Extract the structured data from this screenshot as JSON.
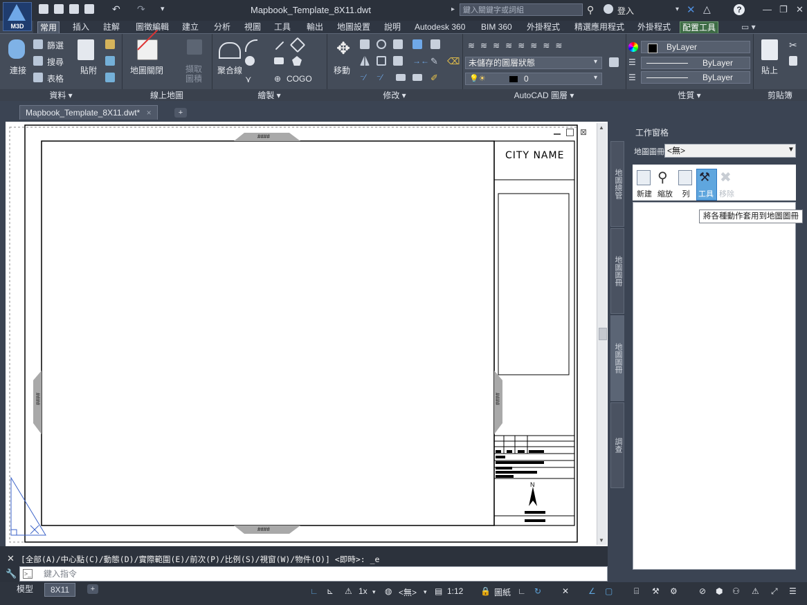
{
  "app": {
    "badge": "M3D",
    "document_title": "Mapbook_Template_8X11.dwt"
  },
  "titlebar": {
    "search_placeholder": "鍵入關鍵字或詞組",
    "login_label": "登入",
    "help_label": "?"
  },
  "ribbon_tabs": [
    {
      "label": "常用"
    },
    {
      "label": "插入"
    },
    {
      "label": "註解"
    },
    {
      "label": "圖徵編輯"
    },
    {
      "label": "建立"
    },
    {
      "label": "分析"
    },
    {
      "label": "視圖"
    },
    {
      "label": "工具"
    },
    {
      "label": "輸出"
    },
    {
      "label": "地圖設置"
    },
    {
      "label": "說明"
    },
    {
      "label": "Autodesk 360"
    },
    {
      "label": "BIM 360"
    },
    {
      "label": "外掛程式"
    },
    {
      "label": "精選應用程式"
    },
    {
      "label": "外掛程式"
    },
    {
      "label": "配置工具"
    }
  ],
  "ribbon": {
    "data_panel": {
      "title": "資料 ▾",
      "connect": "連接",
      "filter": "篩選",
      "search": "搜尋",
      "table": "表格"
    },
    "attach_label": "貼附",
    "online_panel": {
      "title": "線上地圖",
      "close_map": "地圖關閉",
      "extract_area": "擷取圖積"
    },
    "draw_panel": {
      "title": "繪製 ▾",
      "polyline": "聚合線",
      "cogo": "COGO"
    },
    "modify_panel": {
      "title": "修改 ▾",
      "move": "移動"
    },
    "layer_panel": {
      "title": "AutoCAD 圖層 ▾",
      "layer_state": "未儲存的圖層狀態",
      "layer_current": "0"
    },
    "props_panel": {
      "title": "性質 ▾",
      "color": "ByLayer",
      "linetype": "ByLayer",
      "lineweight": "ByLayer"
    },
    "clip_panel": {
      "title": "剪貼簿",
      "paste": "貼上"
    }
  },
  "file_tab": {
    "label": "Mapbook_Template_8X11.dwt*",
    "close": "×"
  },
  "drawing": {
    "city_name": "CITY NAME",
    "hash_mark": "####",
    "north_label": "N"
  },
  "command": {
    "history": "[全部(A)/中心點(C)/動態(D)/實際範圍(E)/前次(P)/比例(S)/視窗(W)/物件(O)] <即時>: _e",
    "placeholder": "鍵入指令"
  },
  "status": {
    "model_tab": "模型",
    "layout_tab": "8X11",
    "scale_x": "1x",
    "none_label": "<無>",
    "viewport_scale": "1:12",
    "paper_label": "圖紙"
  },
  "task_pane": {
    "title": "工作窗格",
    "mapbook_label": "地圖圖冊",
    "mapbook_value": "<無>",
    "buttons": {
      "new": "新建",
      "zoom": "縮放",
      "list": "列",
      "tools": "工具",
      "remove": "移除"
    },
    "tooltip": "將各種動作套用到地圖圖冊",
    "side_tabs": [
      "地圖總管",
      "地圖圖冊",
      "地圖圖冊",
      "調查"
    ]
  },
  "colors": {
    "accent": "#3a78c2",
    "ctx_tab": "#3d6b45"
  }
}
